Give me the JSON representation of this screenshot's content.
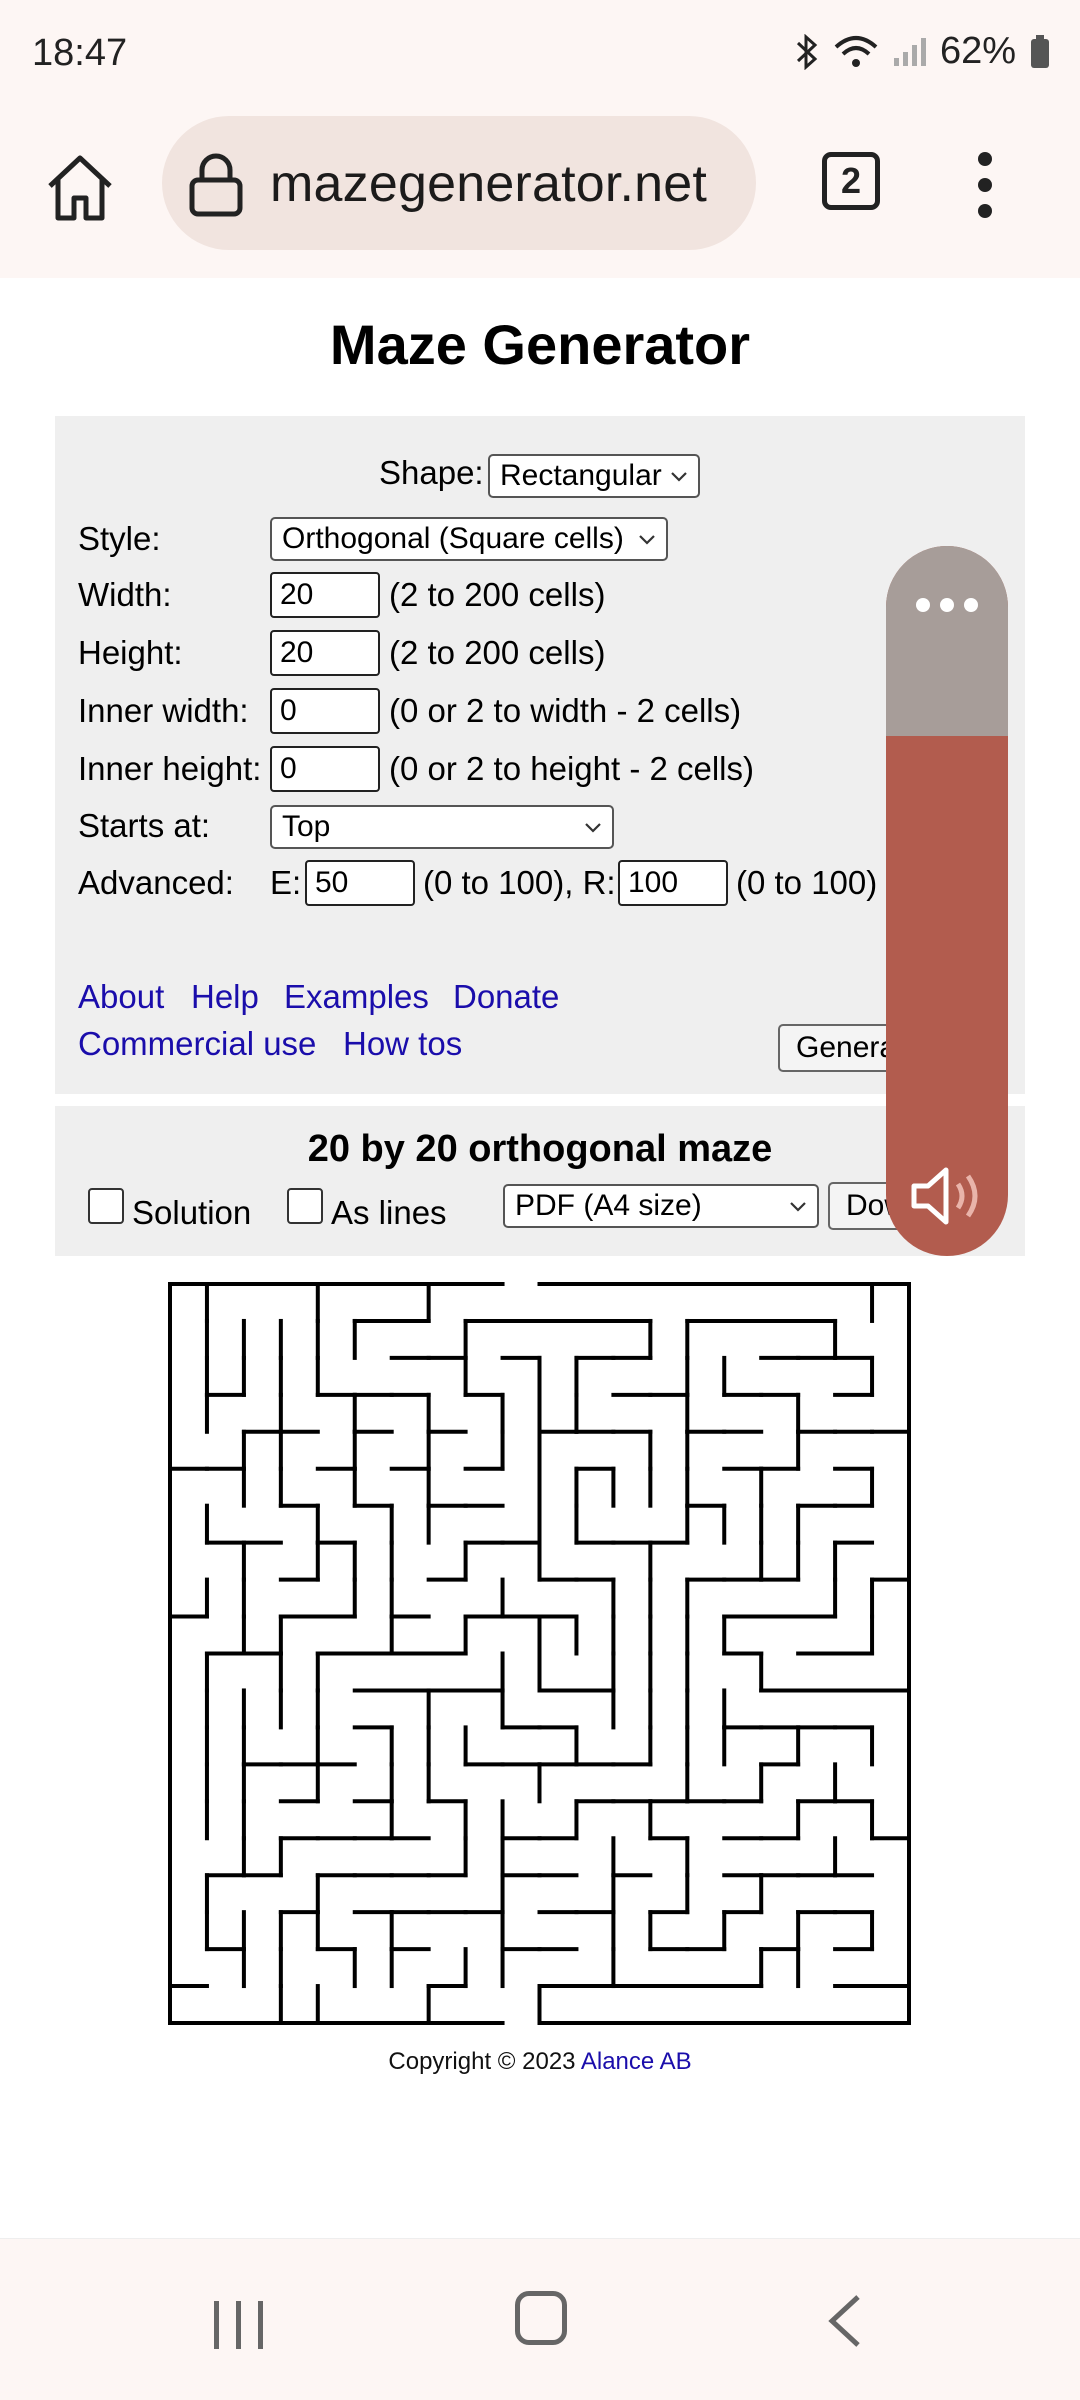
{
  "status_bar": {
    "time": "18:47",
    "battery": "62%"
  },
  "browser": {
    "url": "mazegenerator.net",
    "tab_count": "2"
  },
  "page": {
    "title": "Maze Generator",
    "form": {
      "shape_label": "Shape:",
      "shape_value": "Rectangular",
      "style_label": "Style:",
      "style_value": "Orthogonal (Square cells)",
      "width_label": "Width:",
      "width_value": "20",
      "width_hint": "(2 to 200 cells)",
      "height_label": "Height:",
      "height_value": "20",
      "height_hint": "(2 to 200 cells)",
      "inner_width_label": "Inner width:",
      "inner_width_value": "0",
      "inner_width_hint": "(0 or 2 to width - 2 cells)",
      "inner_height_label": "Inner height:",
      "inner_height_value": "0",
      "inner_height_hint": "(0 or 2 to height - 2 cells)",
      "starts_label": "Starts at:",
      "starts_value": "Top",
      "advanced_label": "Advanced:",
      "e_label": "E:",
      "e_value": "50",
      "e_hint": "(0 to 100), R:",
      "r_value": "100",
      "r_hint": "(0 to 100)",
      "generate_button": "Generate"
    },
    "links": {
      "about": "About",
      "help": "Help",
      "examples": "Examples",
      "donate": "Donate",
      "commercial": "Commercial use",
      "howtos": "How tos"
    },
    "result": {
      "title": "20 by 20 orthogonal maze",
      "solution_label": "Solution",
      "as_lines_label": "As lines",
      "format_value": "PDF (A4 size)",
      "download_button": "Download"
    },
    "copyright_text": "Copyright © 2023",
    "copyright_link": "Alance AB"
  },
  "icons": {
    "home": "home-icon",
    "lock": "lock-icon",
    "menu": "more-vert-icon",
    "volume": "volume-icon",
    "volume_more": "more-horiz-icon",
    "nav_recents": "recents-icon",
    "nav_home": "nav-home-icon",
    "nav_back": "back-icon"
  }
}
